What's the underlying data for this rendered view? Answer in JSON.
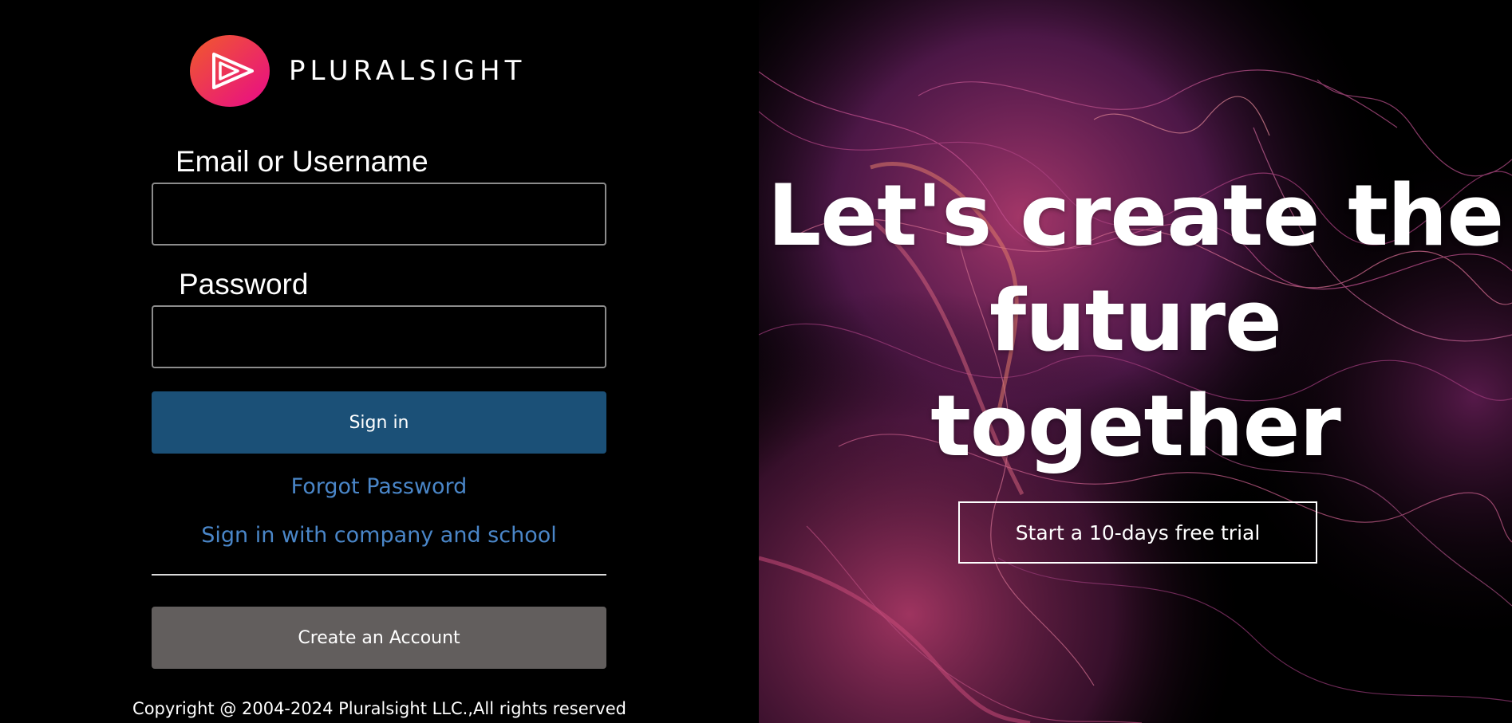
{
  "brand": {
    "name": "PLURALSIGHT",
    "logo_icon": "play-triangle-logo-icon",
    "accent_gradient": [
      "#f15b2a",
      "#e80a89"
    ]
  },
  "login": {
    "email_label": "Email or Username",
    "email_value": "",
    "password_label": "Password",
    "password_value": "",
    "signin_label": "Sign in",
    "forgot_label": "Forgot Password",
    "company_label": "Sign in with company and school",
    "create_label": "Create an Account"
  },
  "footer": {
    "copyright": "Copyright @ 2004-2024 Pluralsight LLC.,All rights reserved"
  },
  "hero": {
    "headline_line1": "Let's create the",
    "headline_line2": "future",
    "headline_line3": "together",
    "trial_label": "Start a 10-days free trial"
  },
  "colors": {
    "background": "#000000",
    "signin_button": "#1b5077",
    "create_button": "#625e5d",
    "link": "#4a86c8"
  }
}
